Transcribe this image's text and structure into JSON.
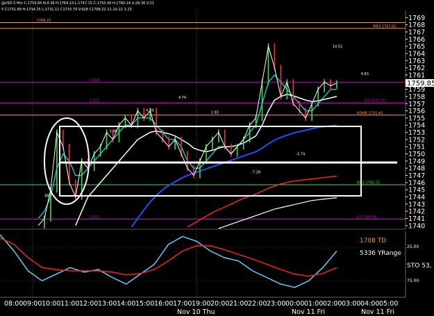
{
  "header": {
    "line1": "@USD 5 Min C:1759.84 N:4.36 H:1764.23 L:1747.15 C:1755.49 H:1760.14 U:26.36 V:11",
    "line2": "5 C1731.69 H:1734.25 L:1731.11 C1733.79 V:928 C1768.22 11-10-22 1:23"
  },
  "colors": {
    "background": "#000000",
    "price_line": "#ffffff",
    "fast_ma": "#00e0e0",
    "slow_ma": "#ffffff",
    "blue_ma": "#1f4fff",
    "red_ma": "#ff2020",
    "pink_level": "#d000d0",
    "orange_level": "#ff9a30",
    "green_level": "#40e040",
    "stoch_line": "#60d0ff",
    "stoch_signal": "#ff2020",
    "candle_up": "#40e040",
    "candle_down": "#ff3030",
    "panel_text": "#ff9a30"
  },
  "chart_data": [
    {
      "type": "line",
      "panel": "price",
      "instrument": "@USD",
      "timeframe": "5 Min",
      "ylim": [
        1739.5,
        1770
      ],
      "y_ticks": [
        1740,
        1741,
        1742,
        1743,
        1744,
        1745,
        1746,
        1747,
        1748,
        1749,
        1750,
        1751,
        1752,
        1753,
        1754,
        1755,
        1756,
        1757,
        1758,
        1759,
        1760,
        1761,
        1762,
        1763,
        1764,
        1765,
        1766,
        1767,
        1768,
        1769
      ],
      "current_price": "1759.85",
      "x_index": [
        0,
        1,
        2,
        3,
        4,
        5,
        6,
        7,
        8,
        9,
        10,
        11,
        12,
        13,
        14,
        15,
        16,
        17,
        18,
        19,
        20,
        21,
        22,
        23,
        24,
        25,
        26,
        27,
        28,
        29,
        30,
        31,
        32,
        33,
        34,
        35,
        36,
        37,
        38,
        39,
        40,
        41,
        42,
        43,
        44,
        45,
        46,
        47,
        48
      ],
      "price": [
        1740,
        1741,
        1745,
        1753,
        1751,
        1746,
        1744,
        1749,
        1748,
        1750,
        1751,
        1753,
        1752,
        1754,
        1755,
        1754,
        1756,
        1755,
        1756,
        1753,
        1752,
        1751,
        1752,
        1750,
        1748,
        1747,
        1749,
        1751,
        1752,
        1753,
        1751,
        1750,
        1751,
        1752,
        1754,
        1755,
        1760,
        1765,
        1762,
        1758,
        1760,
        1757,
        1756,
        1755,
        1757,
        1759,
        1760,
        1759.5,
        1759.85
      ],
      "series": [
        {
          "key": "fast_ma",
          "values": [
            1741,
            1742,
            1744,
            1748,
            1750,
            1749,
            1747,
            1747,
            1748,
            1749,
            1750,
            1751,
            1752,
            1753,
            1754,
            1754,
            1755,
            1755,
            1755,
            1754,
            1753,
            1752,
            1752,
            1751,
            1749,
            1748,
            1748,
            1749,
            1750,
            1751,
            1751,
            1750,
            1751,
            1752,
            1753,
            1754,
            1757,
            1760,
            1761,
            1760,
            1759,
            1758,
            1757,
            1756,
            1756,
            1757,
            1758,
            1759,
            1759
          ]
        },
        {
          "key": "slow_ma",
          "values": [
            null,
            null,
            null,
            null,
            null,
            null,
            1740,
            1742,
            1744,
            1745,
            1746,
            1747,
            1748,
            1749,
            1750,
            1751,
            1752,
            1752.5,
            1753,
            1753.2,
            1753,
            1752.8,
            1752.5,
            1752,
            1751.5,
            1750.8,
            1750.5,
            1750.3,
            1750.5,
            1750.8,
            1751,
            1751,
            1751.2,
            1751.5,
            1752,
            1752.5,
            1754,
            1756,
            1757.5,
            1758,
            1758.3,
            1758.1,
            1757.8,
            1757.5,
            1757.3,
            1757.4,
            1757.6,
            1757.8,
            1758
          ]
        },
        {
          "key": "blue_ma",
          "values": [
            null,
            null,
            null,
            null,
            null,
            null,
            null,
            null,
            null,
            null,
            null,
            null,
            null,
            null,
            null,
            1739.8,
            1741,
            1742.2,
            1743.3,
            1744.2,
            1745,
            1745.6,
            1746.1,
            1746.6,
            1747,
            1747.3,
            1747.6,
            1747.9,
            1748.2,
            1748.5,
            1748.8,
            1749.1,
            1749.4,
            1749.7,
            1750,
            1750.3,
            1750.8,
            1751.4,
            1751.9,
            1752.3,
            1752.6,
            1752.9,
            1753.1,
            1753.3,
            1753.5,
            1753.7,
            1753.8,
            1753.9,
            1754
          ]
        },
        {
          "key": "red_ma",
          "values": [
            null,
            null,
            null,
            null,
            null,
            null,
            null,
            null,
            null,
            null,
            null,
            null,
            null,
            null,
            null,
            null,
            null,
            null,
            null,
            null,
            null,
            null,
            null,
            null,
            1739.8,
            1740.3,
            1740.8,
            1741.3,
            1741.8,
            1742.2,
            1742.6,
            1743,
            1743.4,
            1743.8,
            1744.1,
            1744.4,
            1744.8,
            1745.2,
            1745.5,
            1745.8,
            1746,
            1746.2,
            1746.3,
            1746.4,
            1746.5,
            1746.6,
            1746.7,
            1746.8,
            1746.9
          ]
        },
        {
          "key": "white_ma_lower",
          "values": [
            null,
            null,
            null,
            null,
            null,
            null,
            null,
            null,
            null,
            null,
            null,
            null,
            null,
            null,
            null,
            null,
            null,
            null,
            null,
            null,
            null,
            null,
            null,
            null,
            null,
            null,
            null,
            null,
            null,
            1739.6,
            1739.9,
            1740.2,
            1740.5,
            1740.8,
            1741.1,
            1741.4,
            1741.7,
            1742,
            1742.3,
            1742.5,
            1742.7,
            1742.9,
            1743.1,
            1743.3,
            1743.5,
            1743.6,
            1743.7,
            1743.8,
            1743.9
          ]
        }
      ],
      "levels": [
        {
          "value": 1767.5,
          "label": "MR3 1767.62",
          "color": "orange_level",
          "label_x": 0.92
        },
        {
          "value": 1768.3,
          "label": "1768.22",
          "color": "orange_level",
          "label_x": 0.09
        },
        {
          "value": 1760,
          "label": "1.618",
          "color": "pink_level",
          "label_x": 0.22
        },
        {
          "value": 1757.1,
          "label": "1.272",
          "color": "pink_level",
          "label_x": 0.22
        },
        {
          "value": 1757.1,
          "label": "R1 1757.10",
          "color": "pink_level",
          "label_x": 0.9
        },
        {
          "value": 1755.4,
          "label": "RDMR 1755.40",
          "color": "orange_level",
          "label_x": 0.88
        },
        {
          "value": 1745.7,
          "label": "MR5 1745.72",
          "color": "green_level",
          "label_x": 0.88
        },
        {
          "value": 1740.9,
          "label": "L3 1740.91",
          "color": "pink_level",
          "label_x": 0.88
        },
        {
          "value": 1740.9,
          "label": "1.272",
          "color": "pink_level",
          "label_x": 0.22
        }
      ],
      "annotations": [
        {
          "text": "14.52",
          "x": 0.82,
          "y": 1764.8
        },
        {
          "text": "4.83",
          "x": 0.89,
          "y": 1761.0
        },
        {
          "text": "4.74",
          "x": 0.44,
          "y": 1757.7
        },
        {
          "text": "4.29",
          "x": 0.36,
          "y": 1755.9
        },
        {
          "text": "5.98",
          "x": 0.27,
          "y": 1753.0
        },
        {
          "text": "1.93",
          "x": 0.52,
          "y": 1755.6
        },
        {
          "text": "-7.28",
          "x": 0.62,
          "y": 1747.3
        },
        {
          "text": "-5.74",
          "x": 0.73,
          "y": 1749.8
        },
        {
          "text": "880",
          "x": 0.11,
          "y": 1744.0
        }
      ]
    },
    {
      "type": "line",
      "panel": "stochastic",
      "ylim": [
        0,
        100
      ],
      "tick_labels": [
        "25.00",
        "75.00"
      ],
      "labels": [
        "1708 TD",
        "5336 YRange",
        "STO  53,"
      ],
      "x_index": [
        0,
        2,
        4,
        6,
        8,
        10,
        12,
        14,
        16,
        18,
        20,
        22,
        24,
        26,
        28,
        30,
        32,
        34,
        36,
        38,
        40,
        42,
        44,
        46,
        48
      ],
      "series": [
        {
          "key": "stoch_line",
          "values": [
            95,
            70,
            40,
            25,
            35,
            45,
            38,
            42,
            30,
            20,
            35,
            50,
            80,
            92,
            85,
            70,
            60,
            55,
            40,
            30,
            20,
            15,
            25,
            45,
            70
          ]
        },
        {
          "key": "stoch_signal",
          "values": [
            90,
            80,
            60,
            45,
            42,
            40,
            40,
            40,
            38,
            34,
            36,
            42,
            55,
            70,
            78,
            78,
            72,
            65,
            58,
            50,
            42,
            35,
            32,
            36,
            45
          ]
        }
      ]
    }
  ],
  "time_axis": {
    "labels": [
      "08:00",
      "09:00",
      "10:00",
      "11:00",
      "12:00",
      "13:00",
      "14:00",
      "15:00",
      "16:00",
      "17:00",
      "19:00",
      "20:00",
      "21:00",
      "22:00",
      "23:00",
      "00:00",
      "01:00",
      "02:00",
      "03:00",
      "04:00",
      "05:00"
    ],
    "dates": [
      "Nov 10 Thu",
      "Nov 11 Fri",
      "Nov 11 Fri"
    ]
  }
}
